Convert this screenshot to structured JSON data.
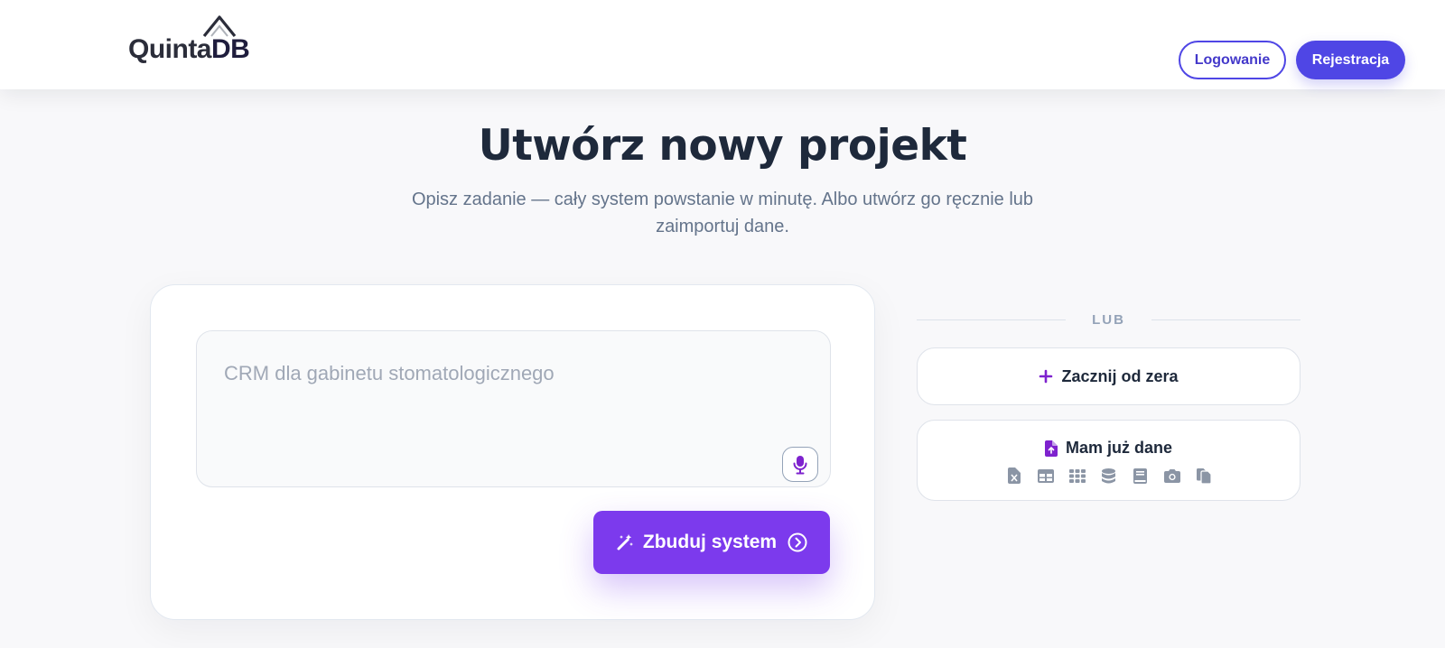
{
  "header": {
    "logo": {
      "text_main": "Quinta",
      "text_accent": "DB"
    },
    "login_label": "Logowanie",
    "register_label": "Rejestracja"
  },
  "main": {
    "title": "Utwórz nowy projekt",
    "subtitle": "Opisz zadanie — cały system powstanie w minutę. Albo utwórz go ręcznie lub zaimportuj dane.",
    "prompt": {
      "value": "",
      "placeholder": "CRM dla gabinetu stomatologicznego"
    },
    "mic_icon": "microphone-icon",
    "build_label": "Zbuduj system"
  },
  "side": {
    "or_label": "LUB",
    "scratch_label": "Zacznij od zera",
    "data_label": "Mam już dane",
    "data_source_icons": [
      "excel-file-icon",
      "table-icon",
      "grid-icon",
      "database-icon",
      "book-icon",
      "camera-icon",
      "copy-files-icon"
    ]
  },
  "colors": {
    "accent_indigo": "#4f46e5",
    "accent_purple": "#7c3aed",
    "icon_purple": "#7e22ce",
    "muted_icon": "#8b95a5",
    "title": "#1e293b",
    "subtitle": "#64748b"
  }
}
